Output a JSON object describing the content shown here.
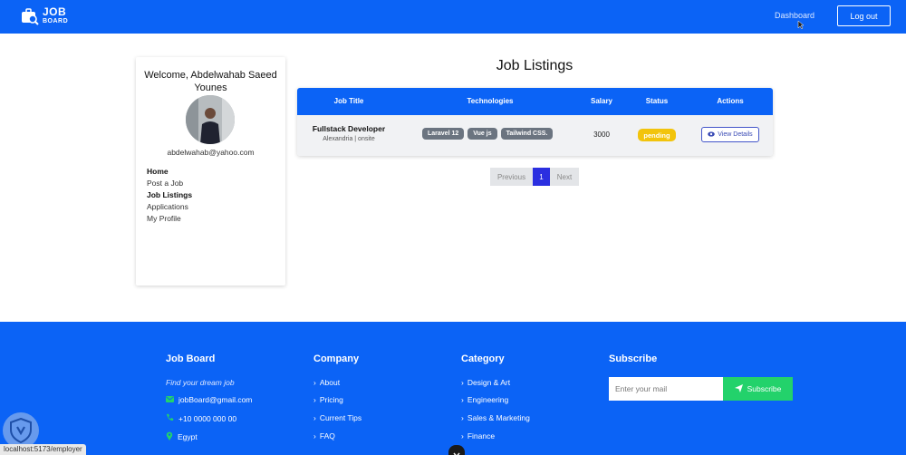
{
  "colors": {
    "primary": "#0b63f6",
    "pending": "#f2c40c",
    "subscribe": "#23d26b",
    "active_page": "#2b2fe0"
  },
  "header": {
    "logo": {
      "line1": "JOB",
      "line2": "BOARD",
      "icon": "briefcase-search-icon"
    },
    "dashboard_label": "Dashboard",
    "logout_label": "Log out"
  },
  "sidebar": {
    "welcome": "Welcome, Abdelwahab Saeed Younes",
    "email": "abdelwahab@yahoo.com",
    "menu": [
      "Home",
      "Post a Job",
      "Job Listings",
      "Applications",
      "My Profile"
    ]
  },
  "main": {
    "title": "Job Listings",
    "table": {
      "columns": [
        "Job Title",
        "Technologies",
        "Salary",
        "Status",
        "Actions"
      ],
      "rows": [
        {
          "title": "Fullstack Developer",
          "location": "Alexandria | onsite",
          "technologies": [
            "Laravel 12",
            "Vue js",
            "Tailwind CSS."
          ],
          "salary": "3000",
          "status": "pending",
          "action": "View Details"
        }
      ]
    },
    "pagination": {
      "prev": "Previous",
      "current": "1",
      "next": "Next"
    }
  },
  "footer": {
    "brand": {
      "heading": "Job Board",
      "tagline": "Find your dream job",
      "email": "jobBoard@gmail.com",
      "phone": "+10 0000 000 00",
      "location": "Egypt"
    },
    "company": {
      "heading": "Company",
      "links": [
        "About",
        "Pricing",
        "Current Tips",
        "FAQ"
      ]
    },
    "category": {
      "heading": "Category",
      "links": [
        "Design & Art",
        "Engineering",
        "Sales & Marketing",
        "Finance"
      ]
    },
    "subscribe": {
      "heading": "Subscribe",
      "placeholder": "Enter your mail",
      "button": "Subscribe"
    }
  },
  "status_bar_url": "localhost:5173/employer"
}
